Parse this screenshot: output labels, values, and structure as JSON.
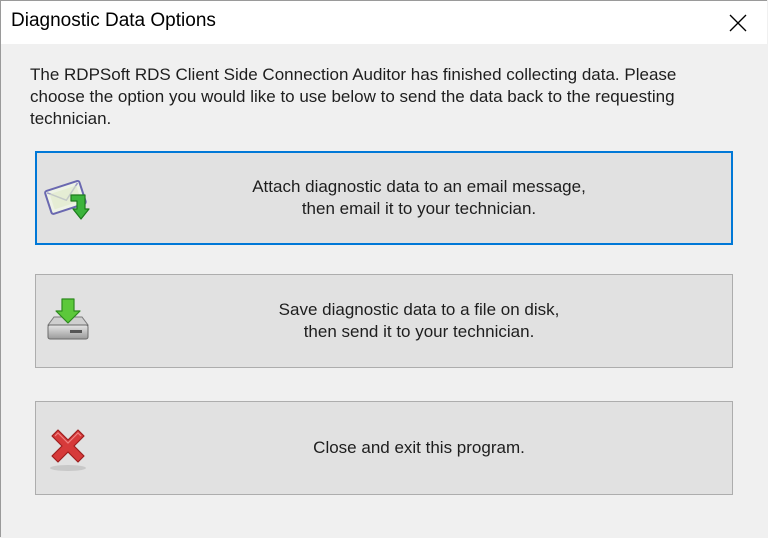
{
  "window": {
    "title": "Diagnostic Data Options"
  },
  "message": {
    "lines": [
      "The RDPSoft RDS Client Side Connection Auditor has finished collecting data.  Please",
      "choose the option you would like to use below to send the data back to the requesting",
      "technician."
    ]
  },
  "options": [
    {
      "icon": "email-attach-icon",
      "line1": "Attach diagnostic data to an email message,",
      "line2": "then email it to your technician.",
      "focused": true
    },
    {
      "icon": "save-to-disk-icon",
      "line1": "Save diagnostic data to a file on disk,",
      "line2": "then send it to your technician.",
      "focused": false
    },
    {
      "icon": "red-x-icon",
      "line1": "Close and exit this program.",
      "focused": false
    }
  ],
  "colors": {
    "focus_border": "#0078d7",
    "button_face": "#e1e1e1",
    "dialog_background": "#f0f0f0"
  }
}
